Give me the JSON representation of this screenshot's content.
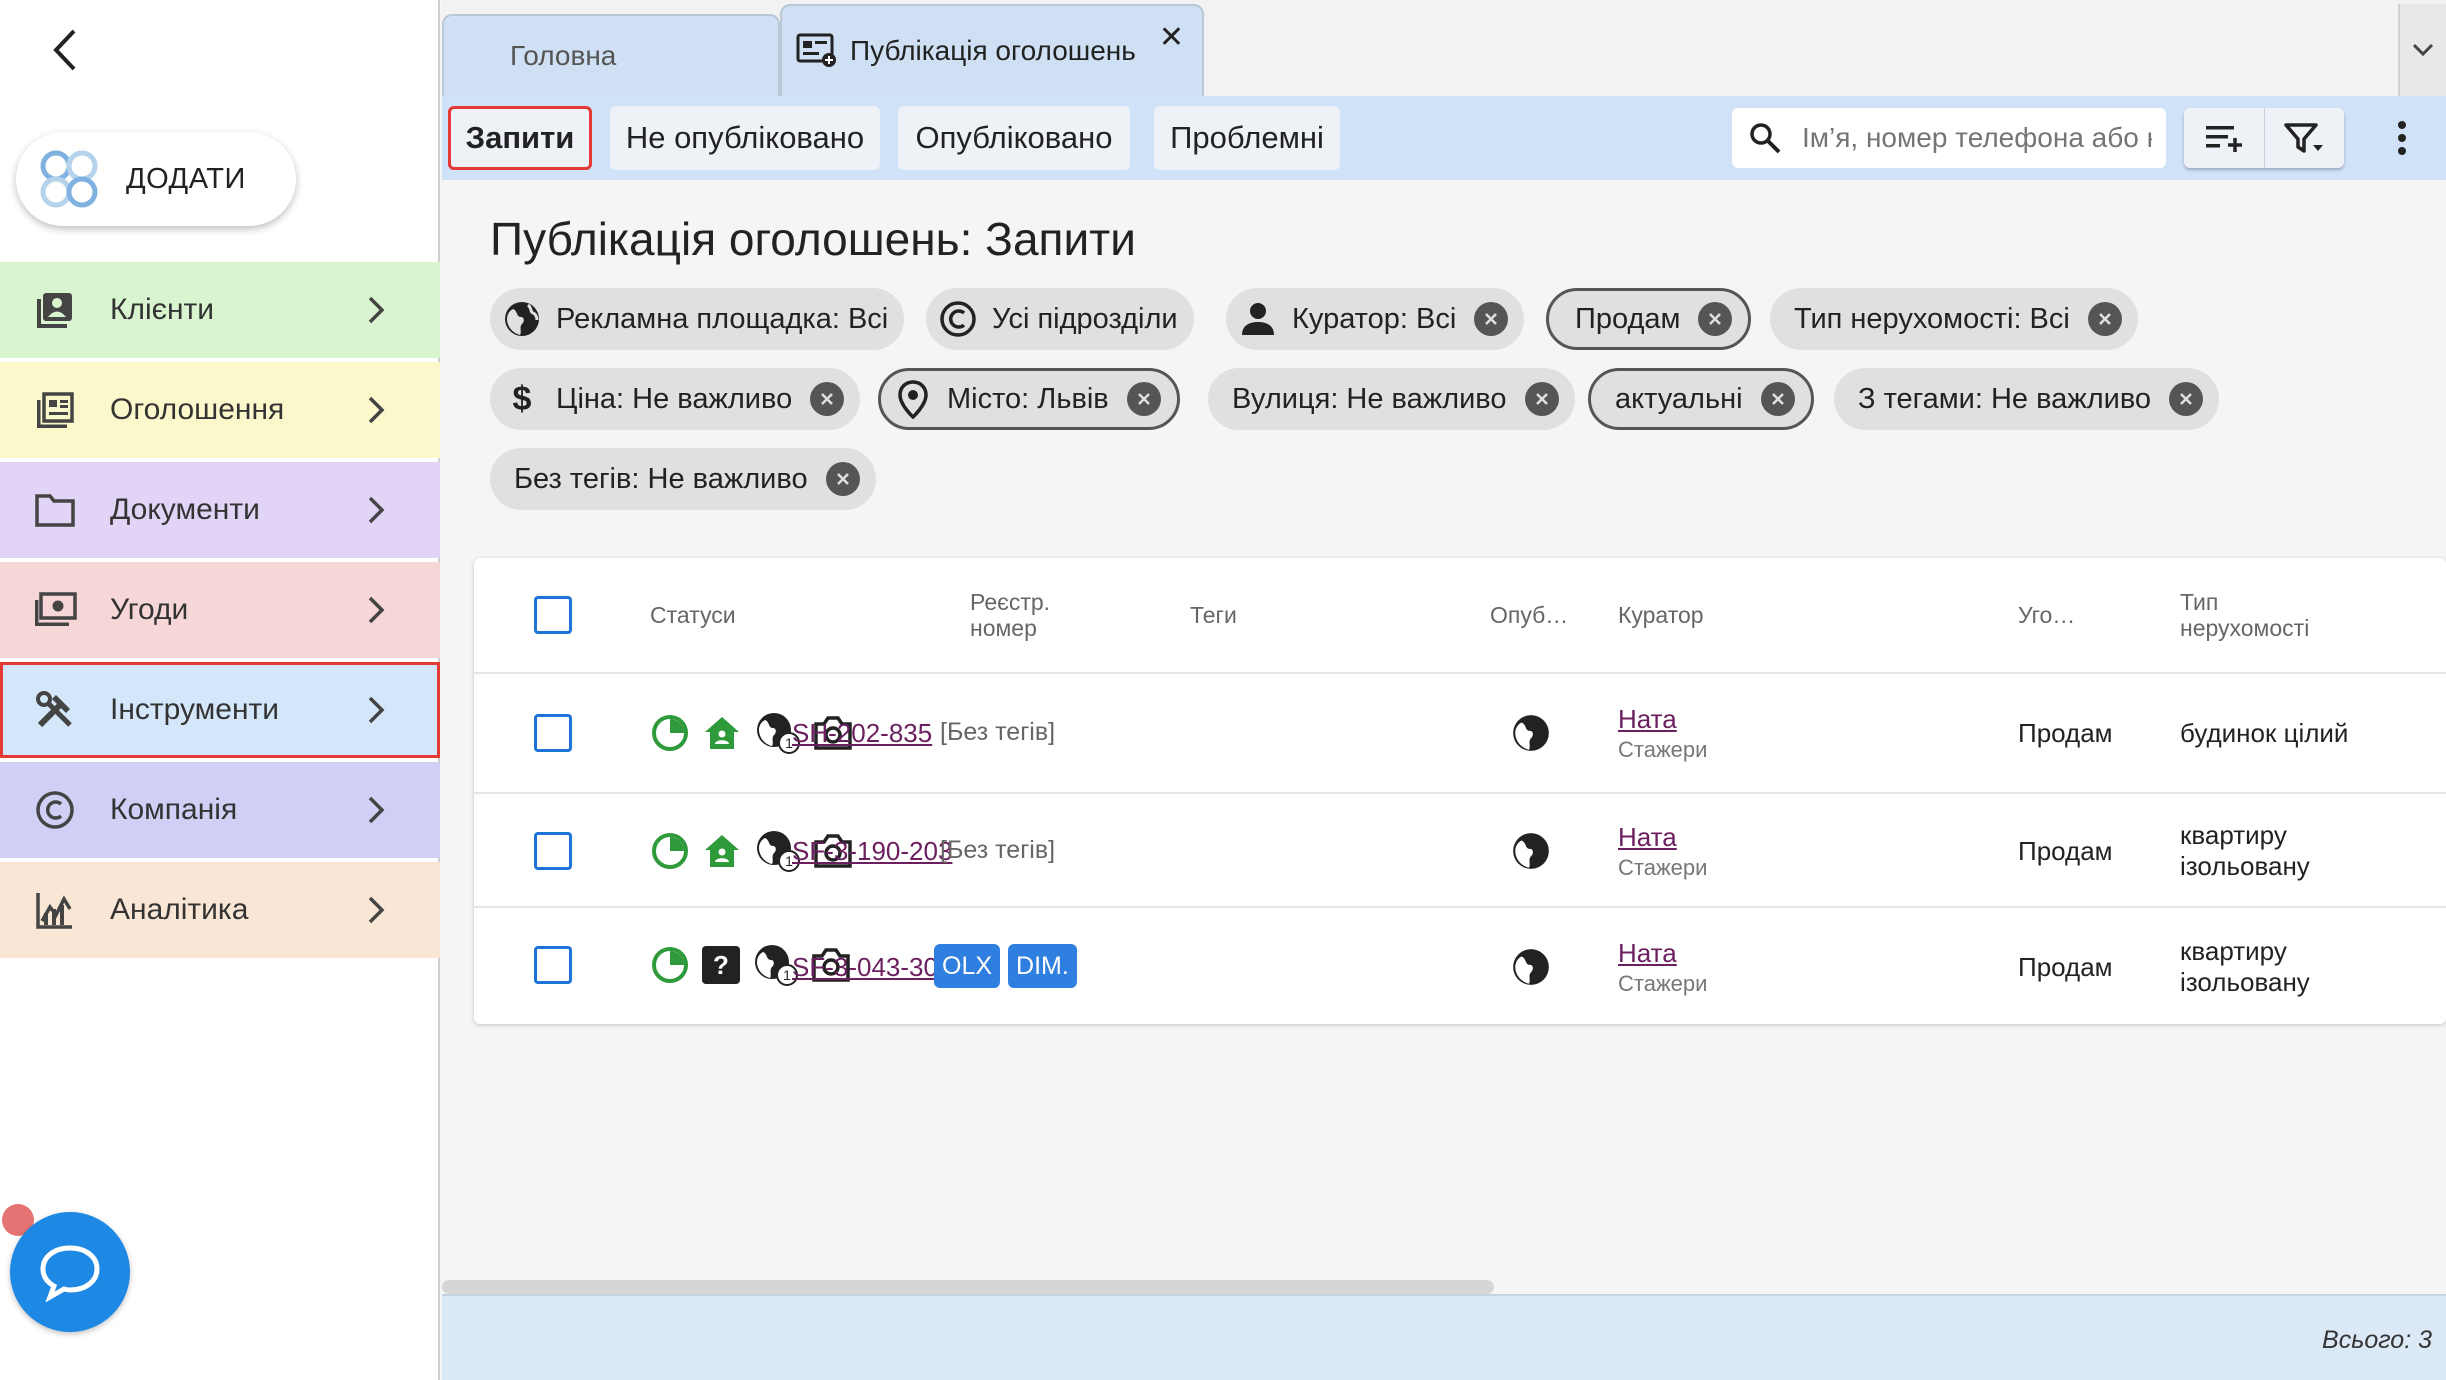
{
  "sidebar": {
    "add_label": "ДОДАТИ",
    "items": [
      {
        "label": "Клієнти",
        "color": "#d9f5d0"
      },
      {
        "label": "Оголошення",
        "color": "#fbf8cc"
      },
      {
        "label": "Документи",
        "color": "#e2d4f7"
      },
      {
        "label": "Угоди",
        "color": "#f6d6d6"
      },
      {
        "label": "Інструменти",
        "color": "#d4e6fa"
      },
      {
        "label": "Компанія",
        "color": "#d0d0f6"
      },
      {
        "label": "Аналітика",
        "color": "#fae6d5"
      }
    ]
  },
  "tabs": {
    "home": "Головна",
    "active": "Публікація оголошень"
  },
  "toolbar": {
    "buttons": [
      "Запити",
      "Не опубліковано",
      "Опубліковано",
      "Проблемні"
    ],
    "search_placeholder": "Ім’я, номер телефона або н"
  },
  "page_title": "Публікація оголошень: Запити",
  "filters": [
    {
      "label": "Рекламна площадка: Всі"
    },
    {
      "label": "Усі підрозділи"
    },
    {
      "label": "Куратор: Всі"
    },
    {
      "label": "Продам"
    },
    {
      "label": "Тип нерухомості: Всі"
    },
    {
      "label": "Ціна: Не важливо"
    },
    {
      "label": "Місто: Львів"
    },
    {
      "label": "Вулиця: Не важливо"
    },
    {
      "label": "актуальні"
    },
    {
      "label": "З тегами: Не важливо"
    },
    {
      "label": "Без тегів: Не важливо"
    }
  ],
  "table": {
    "headers": {
      "statuses": "Статуси",
      "reg_line1": "Реєстр.",
      "reg_line2": "номер",
      "tags": "Теги",
      "published": "Опуб…",
      "curator": "Куратор",
      "deal": "Уго…",
      "type_line1": "Тип",
      "type_line2": "нерухомості"
    },
    "rows": [
      {
        "reg": "SH-202-835",
        "tags_text": "[Без тегів]",
        "curator": "Ната",
        "curator_group": "Стажери",
        "deal": "Продам",
        "type_line1": "будинок цілий",
        "type_line2": "",
        "globe_count": "1"
      },
      {
        "reg": "SF-3-190-203",
        "tags_text": "[Без тегів]",
        "curator": "Ната",
        "curator_group": "Стажери",
        "deal": "Продам",
        "type_line1": "квартиру",
        "type_line2": "ізольовану",
        "globe_count": "1"
      },
      {
        "reg": "SF-3-043-306",
        "tag_badges": [
          "OLX",
          "DIM."
        ],
        "curator": "Ната",
        "curator_group": "Стажери",
        "deal": "Продам",
        "type_line1": "квартиру",
        "type_line2": "ізольовану",
        "globe_count": "1",
        "unknown_mark": "?"
      }
    ]
  },
  "footer": {
    "total": "Всього: 3"
  },
  "colors": {
    "accent_blue": "#1e73d6",
    "status_green": "#2e9a3a",
    "link": "#6b1f5f",
    "highlight_red": "#e53935"
  }
}
